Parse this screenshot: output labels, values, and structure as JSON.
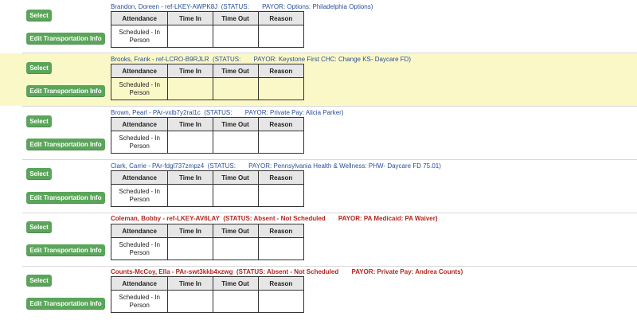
{
  "labels": {
    "select": "Select",
    "transport": "Edit Transportation Info",
    "col_attendance": "Attendance",
    "col_time_in": "Time In",
    "col_time_out": "Time Out",
    "col_reason": "Reason",
    "cell_line1": "Scheduled - In",
    "cell_line2": "Person"
  },
  "rows": [
    {
      "name_ref": "Brandon, Doreen - ref-LKEY-AWPK8J",
      "status": "(STATUS:",
      "payor": "PAYOR: Options: Philadelphia Options)"
    },
    {
      "name_ref": "Brooks, Frank - ref-LCRO-B9RJLR",
      "status": "(STATUS:",
      "payor": "PAYOR: Keystone First CHC: Change KS- Daycare FD)"
    },
    {
      "name_ref": "Brown, Pearl - PAr-vxlb7y2ral1c",
      "status": "(STATUS:",
      "payor": "PAYOR: Private Pay: Alicia Parker)"
    },
    {
      "name_ref": "Clark, Carrie - PAr-fdgl737zmpz4",
      "status": "(STATUS:",
      "payor": "PAYOR: Pennsylvania Health & Wellness: PHW- Daycare FD 75.01)"
    },
    {
      "name_ref": "Coleman, Bobby - ref-LKEY-AV6LAY",
      "status": "(STATUS: Absent - Not Scheduled",
      "payor": "PAYOR: PA Medicaid: PA Waiver)"
    },
    {
      "name_ref": "Counts-McCoy, Ella - PAr-swt3kkb4xzwg",
      "status": "(STATUS: Absent - Not Scheduled",
      "payor": "PAYOR: Private Pay: Andrea Counts)"
    }
  ],
  "colors": {
    "button_green": "#5aa55a",
    "highlight_yellow": "#fbf8c8",
    "link_blue": "#2a4f9a",
    "absent_red": "#b3261e"
  }
}
